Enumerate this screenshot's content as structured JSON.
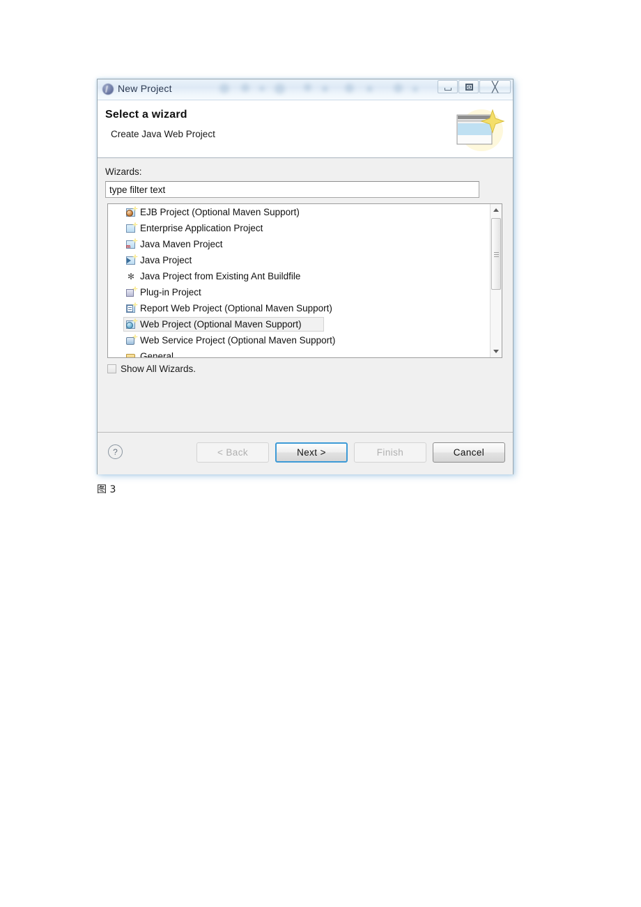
{
  "window": {
    "title": "New Project",
    "icon": "eclipse-icon",
    "controls": [
      {
        "name": "minimize",
        "glyph": "minimize-icon"
      },
      {
        "name": "restore",
        "glyph": "restore-icon"
      },
      {
        "name": "close",
        "glyph": "close-icon",
        "label": "╳"
      }
    ]
  },
  "header": {
    "title": "Select a wizard",
    "subtitle": "Create Java Web Project",
    "banner_icon": "wizard-banner-icon"
  },
  "body": {
    "wizards_label": "Wizards:",
    "filter": {
      "value": "type filter text",
      "placeholder": "type filter text"
    },
    "list": [
      {
        "label": "EJB Project (Optional Maven Support)",
        "icon": "ejb-project-icon",
        "selected": false
      },
      {
        "label": "Enterprise Application Project",
        "icon": "enterprise-application-project-icon",
        "selected": false
      },
      {
        "label": "Java Maven Project",
        "icon": "java-maven-project-icon",
        "selected": false
      },
      {
        "label": "Java Project",
        "icon": "java-project-icon",
        "selected": false
      },
      {
        "label": "Java Project from Existing Ant Buildfile",
        "icon": "ant-buildfile-icon",
        "selected": false
      },
      {
        "label": "Plug-in Project",
        "icon": "plugin-project-icon",
        "selected": false
      },
      {
        "label": "Report Web Project (Optional Maven Support)",
        "icon": "report-web-project-icon",
        "selected": false
      },
      {
        "label": "Web Project (Optional Maven Support)",
        "icon": "web-project-icon",
        "selected": true
      },
      {
        "label": "Web Service Project (Optional Maven Support)",
        "icon": "web-service-project-icon",
        "selected": false
      },
      {
        "label": "General",
        "icon": "folder-icon",
        "selected": false
      }
    ],
    "scrollbar": {
      "up_arrow": "scroll-up-icon",
      "down_arrow": "scroll-down-icon",
      "thumb": "scroll-thumb"
    },
    "show_all_wizards": {
      "label": "Show All Wizards.",
      "checked": false
    }
  },
  "footer": {
    "help_label": "?",
    "buttons": [
      {
        "label": "< Back",
        "name": "back-button",
        "state": "disabled"
      },
      {
        "label": "Next >",
        "name": "next-button",
        "state": "default"
      },
      {
        "label": "Finish",
        "name": "finish-button",
        "state": "disabled"
      },
      {
        "label": "Cancel",
        "name": "cancel-button",
        "state": "enabled"
      }
    ]
  },
  "caption": "图 3",
  "colors": {
    "titlebar_start": "#e9f2fa",
    "titlebar_end": "#f7fbfe",
    "dialog_bg": "#f0f0f0",
    "header_bg": "#ffffff",
    "list_bg": "#ffffff",
    "selection_bg": "#f1f1f1",
    "default_button_border": "#3d9ad6",
    "disabled_text": "#b0b0b0"
  }
}
